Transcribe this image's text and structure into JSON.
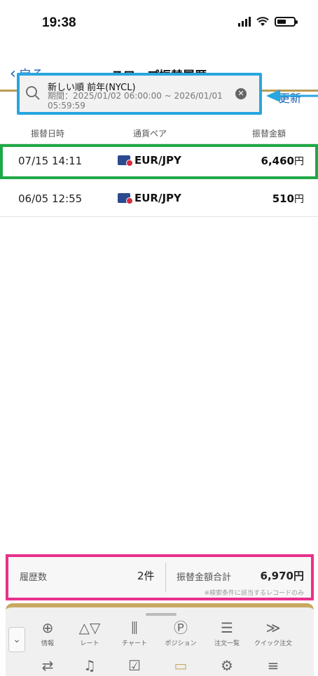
{
  "status_bar": {
    "time": "19:38"
  },
  "nav": {
    "back_label": "戻る",
    "title": "スワップ振替履歴"
  },
  "filter": {
    "line1": "新しい順 前年(NYCL)",
    "line2": "期間：2025/01/02 06:00:00 ~ 2026/01/01 05:59:59",
    "refresh_label": "更新"
  },
  "columns": [
    "振替日時",
    "通貨ペア",
    "振替金額"
  ],
  "rows": [
    {
      "datetime": "07/15 14:11",
      "pair": "EUR/JPY",
      "amount": "6,460",
      "unit": "円"
    },
    {
      "datetime": "06/05 12:55",
      "pair": "EUR/JPY",
      "amount": "510",
      "unit": "円"
    }
  ],
  "summary": {
    "count_label": "履歴数",
    "count_value": "2件",
    "total_label": "振替金額合計",
    "total_value": "6,970円",
    "note": "※検索条件に該当するレコードのみ"
  },
  "tabbar": {
    "row1": [
      {
        "icon": "globe-icon",
        "label": "情報"
      },
      {
        "icon": "rate-icon",
        "label": "レート"
      },
      {
        "icon": "chart-icon",
        "label": "チャート"
      },
      {
        "icon": "position-icon",
        "label": "ポジション"
      },
      {
        "icon": "order-list-icon",
        "label": "注文一覧"
      },
      {
        "icon": "quick-order-icon",
        "label": "クイック注文"
      }
    ],
    "row2": [
      {
        "icon": "transfer-icon"
      },
      {
        "icon": "bell-icon"
      },
      {
        "icon": "checklist-icon"
      },
      {
        "icon": "card-icon"
      },
      {
        "icon": "settings-icon"
      },
      {
        "icon": "menu-icon"
      }
    ]
  },
  "colors": {
    "accent_blue": "#1a5fb4",
    "gold": "#c7a962",
    "highlight_green": "#1fa847",
    "highlight_pink": "#e8318c",
    "highlight_cyan": "#27a6e0"
  }
}
